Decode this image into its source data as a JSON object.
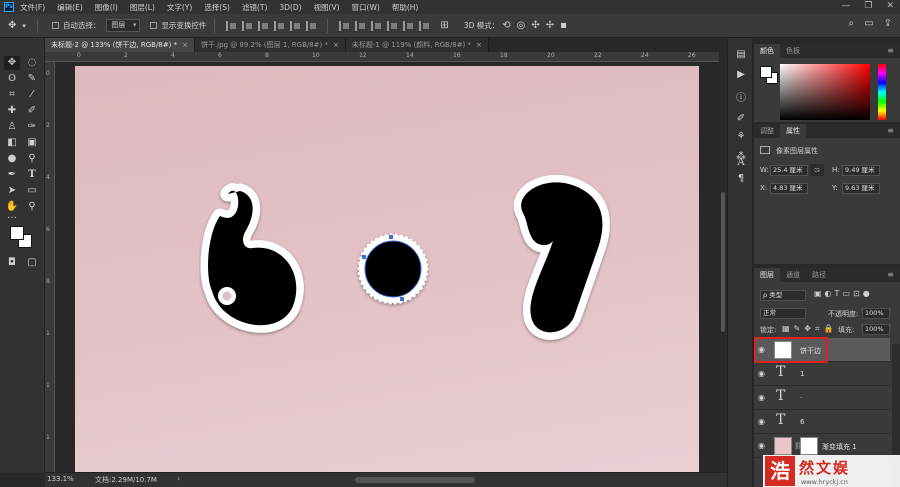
{
  "menu": [
    "文件(F)",
    "编辑(E)",
    "图像(I)",
    "图层(L)",
    "文字(Y)",
    "选择(S)",
    "滤镜(T)",
    "3D(D)",
    "视图(V)",
    "窗口(W)",
    "帮助(H)"
  ],
  "app_logo": "Ps",
  "window_controls": [
    "—",
    "❐",
    "✕"
  ],
  "options": {
    "auto_select_label": "自动选择：",
    "auto_select_value": "图层",
    "show_transform_label": "显示变换控件",
    "mode_3d_label": "3D 模式："
  },
  "tabs": [
    {
      "label": "未标题-2 @ 133% (饼干边, RGB/8#) *",
      "close": "×"
    },
    {
      "label": "饼干.jpg @ 89.2% (图层 1, RGB/8#) *",
      "close": "×"
    },
    {
      "label": "未标题-1 @ 119% (颜料, RGB/8#) *",
      "close": "×"
    }
  ],
  "ruler_top_labels": [
    "0",
    "2",
    "4",
    "6",
    "8",
    "10",
    "12",
    "14",
    "16",
    "18",
    "20",
    "22",
    "24",
    "26"
  ],
  "ruler_left_labels": [
    "0",
    "2",
    "4",
    "6",
    "8",
    "1",
    "1",
    "1"
  ],
  "canvas_colors": {
    "background": "#e1bfc4",
    "shape": "#000000",
    "outline": "#ffffff",
    "path": "#3a6fd8"
  },
  "status": {
    "zoom": "133.1%",
    "doc_size": "文档:2.29M/10.7M"
  },
  "color_panel": {
    "tabs": [
      "颜色",
      "色板"
    ]
  },
  "properties": {
    "tabs": [
      "调整",
      "属性"
    ],
    "header": "像素图层属性",
    "w_label": "W:",
    "w_value": "25.4 厘米",
    "h_label": "H:",
    "h_value": "9.49 厘米",
    "x_label": "X:",
    "x_value": "4.83 厘米",
    "y_label": "Y:",
    "y_value": "9.63 厘米",
    "link": "ශ"
  },
  "layers": {
    "tabs": [
      "图层",
      "通道",
      "路径"
    ],
    "filter": "ρ 类型",
    "blend_mode": "正常",
    "opacity_label": "不透明度:",
    "opacity_value": "100%",
    "lock_label": "锁定:",
    "fill_label": "填充:",
    "fill_value": "100%",
    "items": [
      {
        "name": "饼干边",
        "kind": "pixel",
        "selected": true
      },
      {
        "name": "1",
        "kind": "text",
        "selected": false
      },
      {
        "name": "·",
        "kind": "text",
        "selected": false
      },
      {
        "name": "6",
        "kind": "text",
        "selected": false
      },
      {
        "name": "渐变填充 1",
        "kind": "gradient",
        "selected": false
      }
    ]
  },
  "watermark": {
    "seal": "浩",
    "name": "然文娱",
    "url": "www.hryckj.cn"
  }
}
